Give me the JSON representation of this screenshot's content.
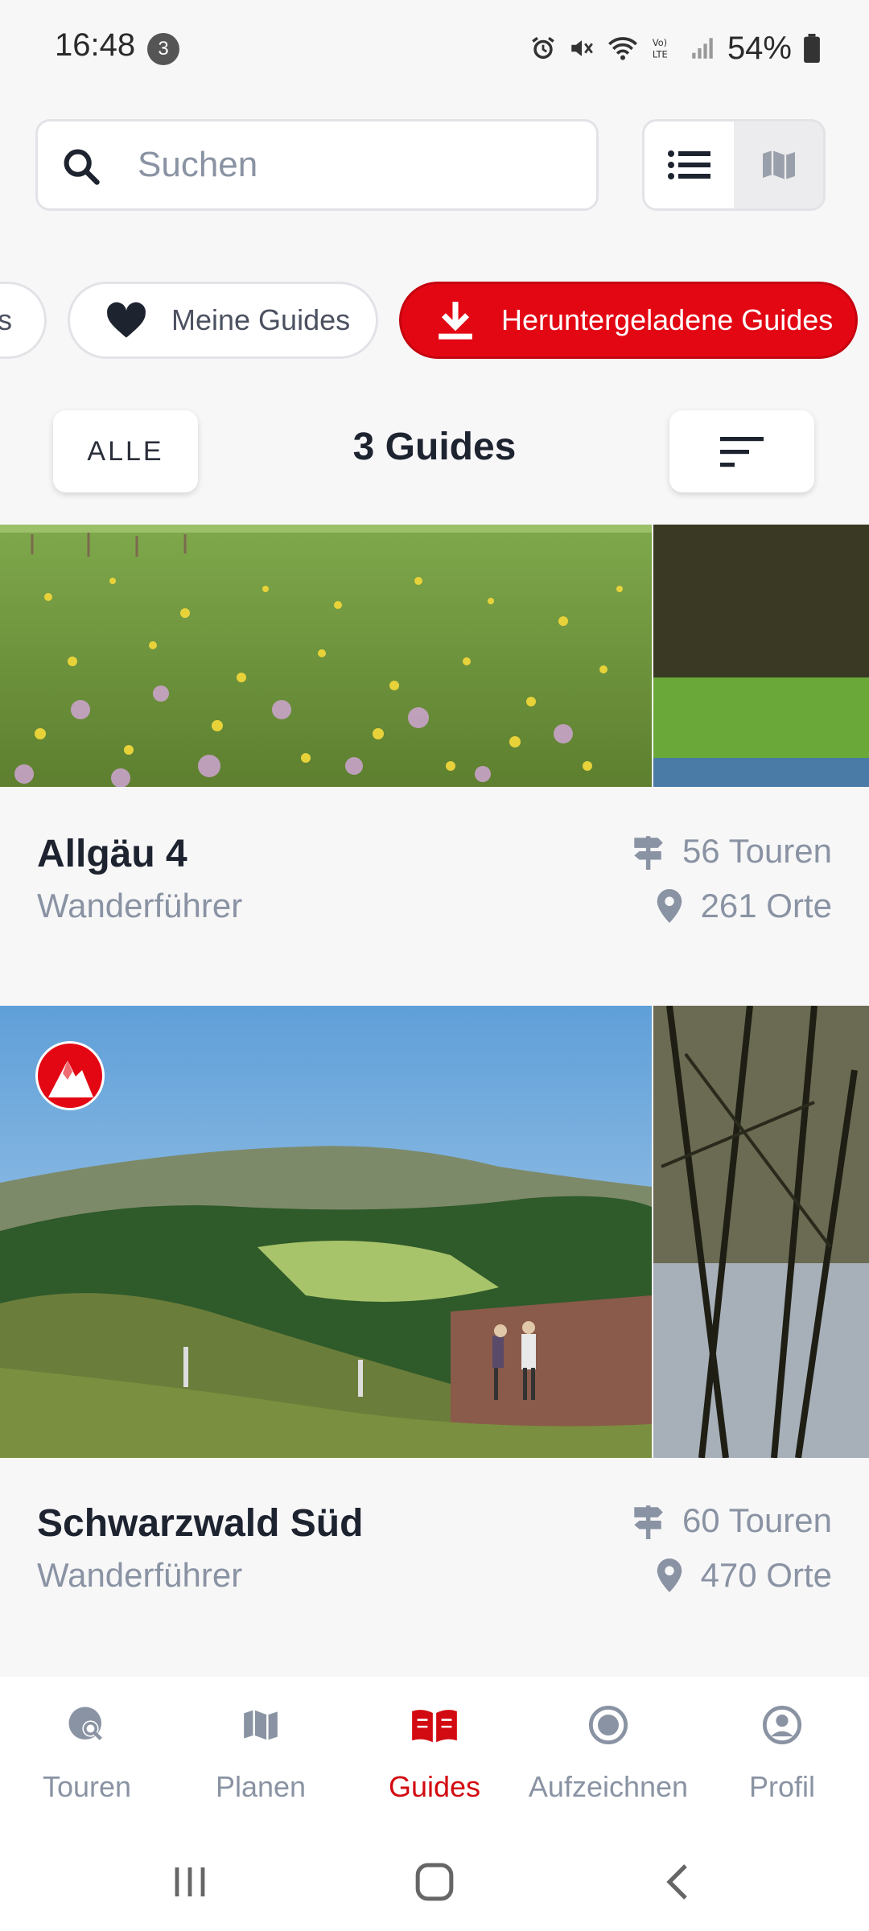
{
  "status_bar": {
    "time": "16:48",
    "notification_count": "3",
    "battery_percent": "54%",
    "icons": [
      "alarm-icon",
      "mute-icon",
      "wifi-icon",
      "volte-icon",
      "signal-icon",
      "battery-icon"
    ]
  },
  "search": {
    "placeholder": "Suchen"
  },
  "view_toggle": {
    "active": "list",
    "options": [
      "list-icon",
      "map-icon"
    ]
  },
  "chips": {
    "partial_label": "s",
    "favorites_label": "Meine Guides",
    "downloaded_label": "Heruntergeladene Guides"
  },
  "filter": {
    "all_label": "ALLE",
    "count_label": "3 Guides"
  },
  "guides": [
    {
      "title": "Allgäu 4",
      "subtitle": "Wanderführer",
      "tours": "56 Touren",
      "places": "261 Orte"
    },
    {
      "title": "Schwarzwald Süd",
      "subtitle": "Wanderführer",
      "tours": "60 Touren",
      "places": "470 Orte"
    }
  ],
  "bottom_nav": {
    "items": [
      {
        "label": "Touren",
        "icon": "globe-search-icon"
      },
      {
        "label": "Planen",
        "icon": "map-icon"
      },
      {
        "label": "Guides",
        "icon": "book-icon"
      },
      {
        "label": "Aufzeichnen",
        "icon": "record-icon"
      },
      {
        "label": "Profil",
        "icon": "profile-icon"
      }
    ],
    "active": "Guides"
  },
  "colors": {
    "accent": "#e30613",
    "text_primary": "#1e2330",
    "text_secondary": "#8a93a3"
  }
}
